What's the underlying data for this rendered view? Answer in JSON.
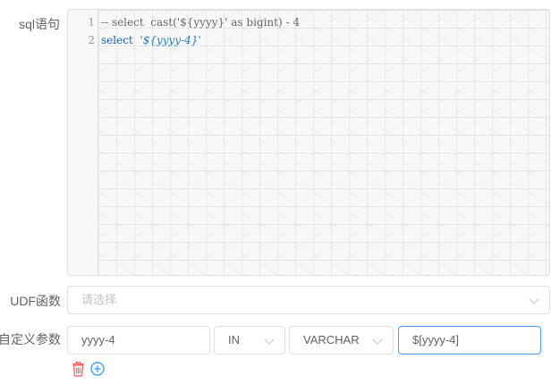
{
  "labels": {
    "sql": "sql语句",
    "udf": "UDF函数",
    "custom_params": "自定义参数"
  },
  "editor": {
    "line_numbers": [
      "1",
      "2"
    ],
    "line1": "-- select  cast('${yyyy}' as bigint) - 4",
    "line2_keyword": "select",
    "line2_string": "'${yyyy-4}'"
  },
  "udf_select": {
    "placeholder": "请选择"
  },
  "custom_param": {
    "name": "yyyy-4",
    "direction": "IN",
    "type": "VARCHAR",
    "value": "$[yyyy-4]"
  },
  "icons": {
    "delete": "trash-icon",
    "add": "plus-circle-icon"
  },
  "colors": {
    "delete": "#f56c6c",
    "add": "#409eff",
    "focus_border": "#409eff"
  }
}
